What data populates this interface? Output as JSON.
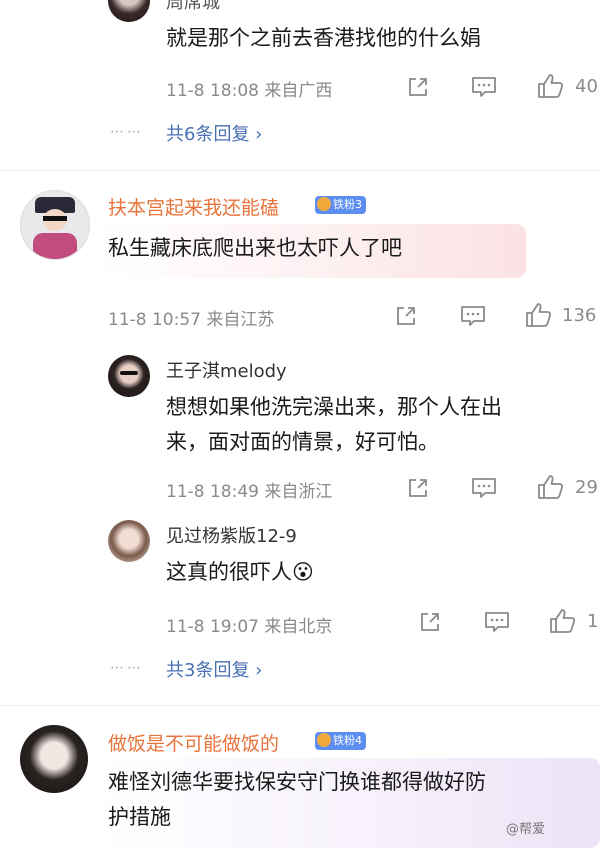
{
  "reply_top": {
    "username": "周席城",
    "text": "就是那个之前去香港找他的什么娟",
    "meta": "11-8 18:08 来自广西",
    "likes": "40",
    "more_dots": "⋯⋯",
    "more_replies": "共6条回复 ›"
  },
  "comment1": {
    "username": "扶本宫起来我还能磕",
    "badge": "铁粉3",
    "text": "私生藏床底爬出来也太吓人了吧",
    "meta": "11-8 10:57 来自江苏",
    "likes": "136",
    "replies": [
      {
        "username": "王子淇melody",
        "text_line1": "想想如果他洗完澡出来，那个人在出",
        "text_line2": "来，面对面的情景，好可怕。",
        "meta": "11-8 18:49 来自浙江",
        "likes": "29"
      },
      {
        "username": "见过杨紫版12-9",
        "text": "这真的很吓人",
        "emoji": "😮",
        "meta": "11-8 19:07 来自北京",
        "likes": "1"
      }
    ],
    "more_dots": "⋯⋯",
    "more_replies": "共3条回复 ›"
  },
  "comment2": {
    "username": "做饭是不可能做饭的",
    "badge": "铁粉4",
    "text_line1": "难怪刘德华要找保安守门换谁都得做好防",
    "text_line2": "护措施"
  },
  "watermark": "@帮爱",
  "colors": {
    "username_accent": "#e8743b",
    "link": "#4a6fb5",
    "badge": "#5b8ef0",
    "meta": "#8a8a8a"
  }
}
